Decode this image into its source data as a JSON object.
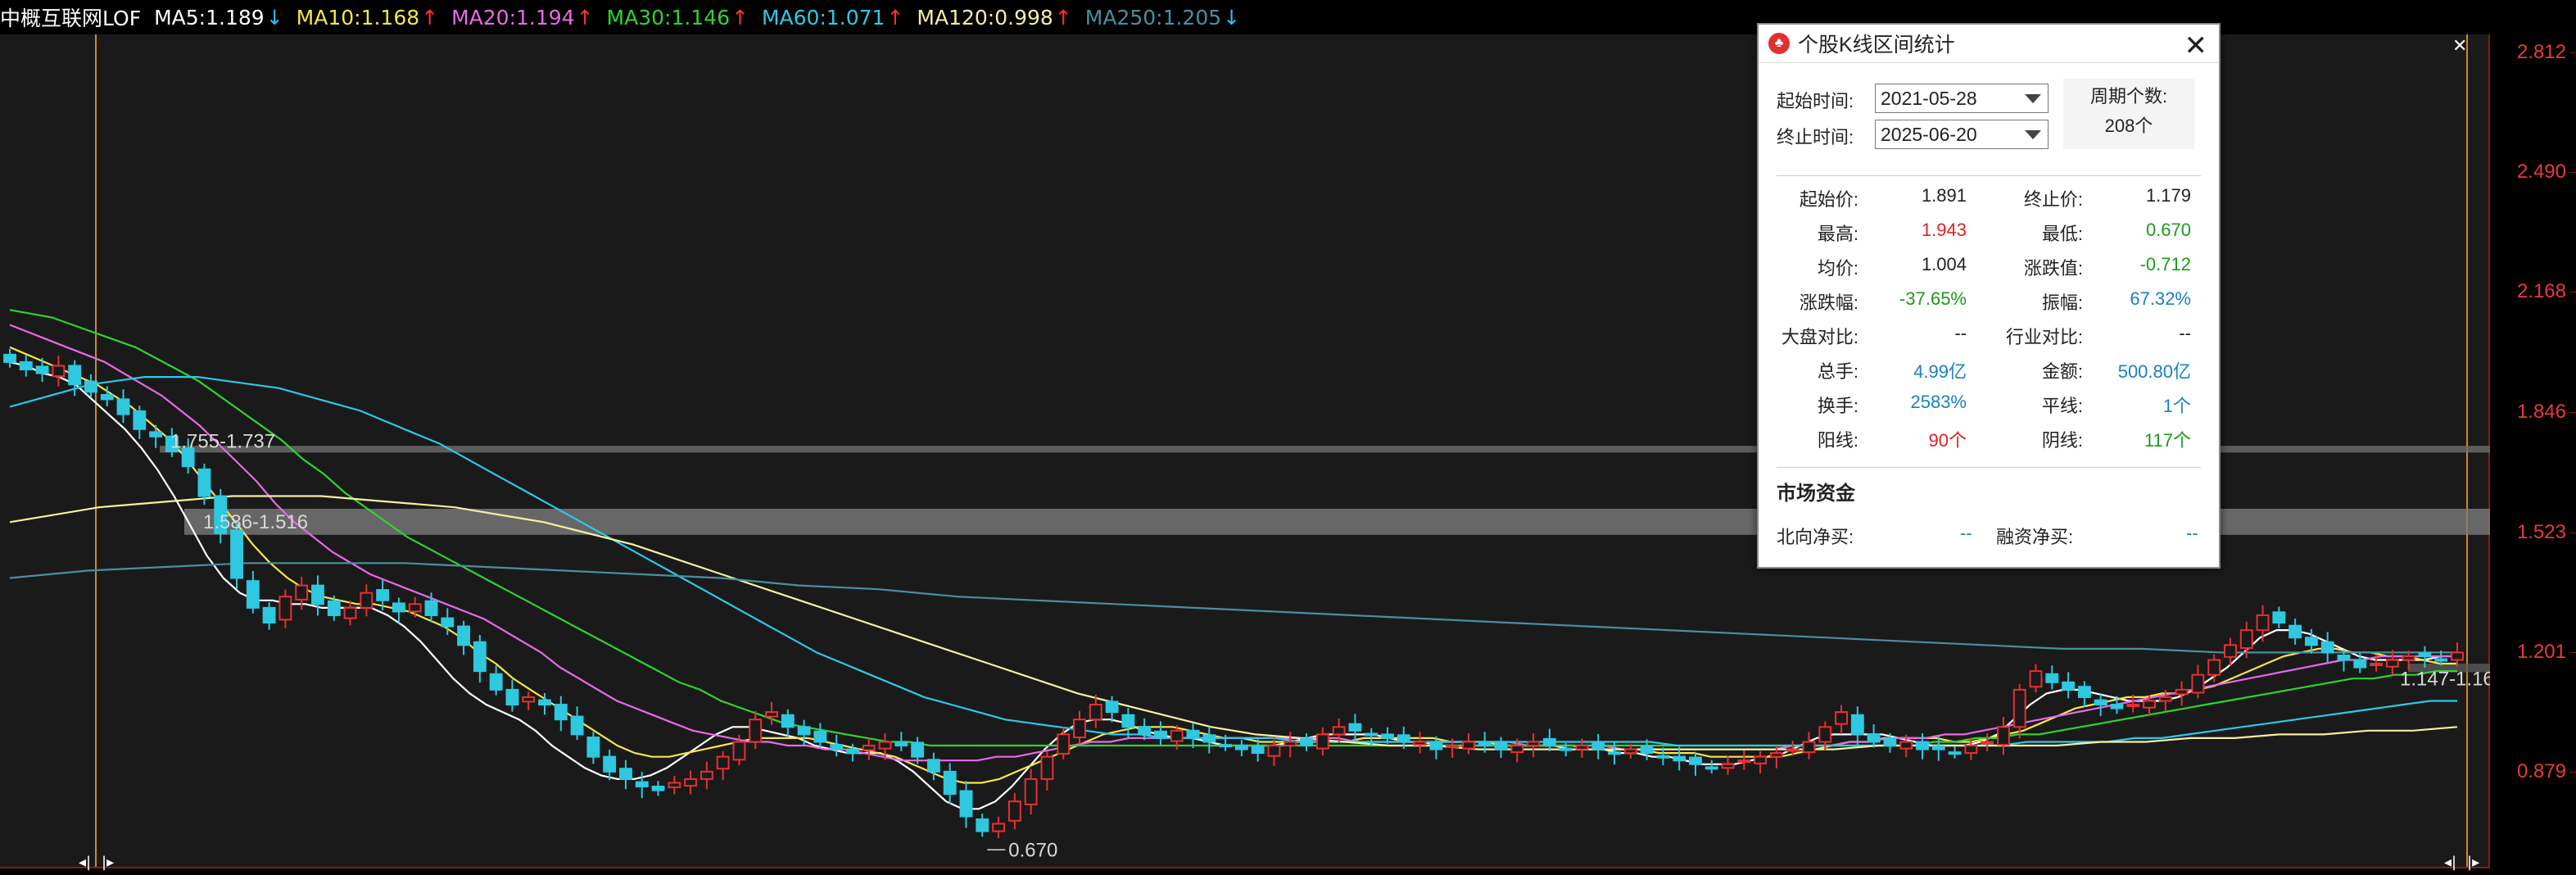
{
  "header": {
    "title": "中概互联网LOF",
    "indicators": [
      {
        "label": "MA5:",
        "value": "1.189",
        "arrow": "↓",
        "color": "#ffffff"
      },
      {
        "label": "MA10:",
        "value": "1.168",
        "arrow": "↑",
        "color": "#f5e64a"
      },
      {
        "label": "MA20:",
        "value": "1.194",
        "arrow": "↑",
        "color": "#e86ae8"
      },
      {
        "label": "MA30:",
        "value": "1.146",
        "arrow": "↑",
        "color": "#2fd42f"
      },
      {
        "label": "MA60:",
        "value": "1.071",
        "arrow": "↑",
        "color": "#2ec8e8"
      },
      {
        "label": "MA120:",
        "value": "0.998",
        "arrow": "↑",
        "color": "#f5f0a0"
      },
      {
        "label": "MA250:",
        "value": "1.205",
        "arrow": "↓",
        "color": "#4a8ea0"
      }
    ],
    "arrow_up_color": "#ff3030",
    "arrow_down_color": "#30c0f0"
  },
  "price_axis": [
    "2.812",
    "2.490",
    "2.168",
    "1.846",
    "1.523",
    "1.201",
    "0.879"
  ],
  "chart_annotations": {
    "zone1": "1.755-1.737",
    "zone2": "1.586-1.516",
    "zone3": "1.147-1.16",
    "low_label": "0.670"
  },
  "chart_data": {
    "type": "candlestick",
    "y_range": [
      0.62,
      2.86
    ],
    "up_color": "#e83030",
    "down_color": "#2ec8e0",
    "close_series": [
      1.98,
      1.96,
      1.95,
      1.97,
      1.92,
      1.9,
      1.88,
      1.84,
      1.8,
      1.78,
      1.74,
      1.7,
      1.62,
      1.52,
      1.4,
      1.32,
      1.28,
      1.35,
      1.38,
      1.33,
      1.3,
      1.32,
      1.36,
      1.34,
      1.31,
      1.33,
      1.3,
      1.27,
      1.22,
      1.15,
      1.1,
      1.06,
      1.08,
      1.06,
      1.02,
      0.98,
      0.92,
      0.88,
      0.86,
      0.84,
      0.83,
      0.85,
      0.86,
      0.88,
      0.92,
      0.96,
      1.02,
      1.04,
      1.0,
      0.98,
      0.96,
      0.94,
      0.93,
      0.95,
      0.96,
      0.95,
      0.92,
      0.88,
      0.82,
      0.76,
      0.72,
      0.74,
      0.8,
      0.86,
      0.92,
      0.98,
      1.02,
      1.06,
      1.04,
      1.0,
      0.98,
      0.97,
      0.99,
      0.97,
      0.96,
      0.95,
      0.94,
      0.93,
      0.95,
      0.96,
      0.95,
      0.98,
      1.0,
      0.99,
      0.98,
      0.97,
      0.96,
      0.96,
      0.94,
      0.95,
      0.96,
      0.95,
      0.94,
      0.95,
      0.96,
      0.95,
      0.94,
      0.95,
      0.94,
      0.93,
      0.94,
      0.93,
      0.92,
      0.91,
      0.9,
      0.89,
      0.9,
      0.91,
      0.92,
      0.93,
      0.94,
      0.96,
      1.0,
      1.04,
      0.98,
      0.96,
      0.95,
      0.96,
      0.94,
      0.94,
      0.93,
      0.95,
      0.96,
      1.0,
      1.1,
      1.15,
      1.12,
      1.1,
      1.08,
      1.06,
      1.05,
      1.06,
      1.07,
      1.08,
      1.1,
      1.14,
      1.18,
      1.22,
      1.26,
      1.3,
      1.28,
      1.24,
      1.22,
      1.2,
      1.18,
      1.16,
      1.17,
      1.18,
      1.19,
      1.19,
      1.18,
      1.2
    ],
    "ma_series": [
      {
        "name": "MA5",
        "color": "#ffffff",
        "values": [
          1.98,
          1.97,
          1.95,
          1.94,
          1.92,
          1.88,
          1.84,
          1.8,
          1.75,
          1.69,
          1.62,
          1.54,
          1.46,
          1.4,
          1.36,
          1.34,
          1.34,
          1.33,
          1.33,
          1.32,
          1.32,
          1.32,
          1.32,
          1.3,
          1.27,
          1.23,
          1.18,
          1.13,
          1.09,
          1.06,
          1.04,
          1.02,
          0.99,
          0.95,
          0.92,
          0.89,
          0.87,
          0.86,
          0.86,
          0.87,
          0.89,
          0.92,
          0.95,
          0.98,
          1.0,
          1.0,
          0.99,
          0.98,
          0.97,
          0.95,
          0.94,
          0.93,
          0.93,
          0.93,
          0.91,
          0.88,
          0.84,
          0.8,
          0.78,
          0.78,
          0.8,
          0.84,
          0.89,
          0.94,
          0.98,
          1.01,
          1.02,
          1.02,
          1.01,
          0.99,
          0.98,
          0.97,
          0.97,
          0.96,
          0.95,
          0.95,
          0.95,
          0.95,
          0.96,
          0.97,
          0.98,
          0.98,
          0.98,
          0.98,
          0.97,
          0.96,
          0.96,
          0.95,
          0.95,
          0.95,
          0.95,
          0.95,
          0.95,
          0.95,
          0.95,
          0.94,
          0.94,
          0.94,
          0.93,
          0.93,
          0.92,
          0.92,
          0.91,
          0.9,
          0.9,
          0.9,
          0.91,
          0.92,
          0.93,
          0.95,
          0.97,
          0.98,
          0.98,
          0.98,
          0.98,
          0.97,
          0.96,
          0.95,
          0.95,
          0.95,
          0.96,
          0.98,
          1.02,
          1.06,
          1.09,
          1.1,
          1.1,
          1.09,
          1.08,
          1.07,
          1.07,
          1.07,
          1.08,
          1.1,
          1.13,
          1.16,
          1.2,
          1.24,
          1.26,
          1.26,
          1.25,
          1.23,
          1.21,
          1.19,
          1.18,
          1.18,
          1.18,
          1.18,
          1.19,
          1.19
        ]
      },
      {
        "name": "MA10",
        "color": "#f5e64a",
        "values": [
          2.02,
          2.0,
          1.98,
          1.96,
          1.94,
          1.92,
          1.89,
          1.86,
          1.82,
          1.78,
          1.73,
          1.67,
          1.61,
          1.55,
          1.49,
          1.44,
          1.4,
          1.37,
          1.35,
          1.34,
          1.33,
          1.33,
          1.32,
          1.31,
          1.29,
          1.27,
          1.24,
          1.2,
          1.17,
          1.13,
          1.1,
          1.07,
          1.04,
          1.01,
          0.98,
          0.95,
          0.93,
          0.92,
          0.92,
          0.93,
          0.94,
          0.95,
          0.96,
          0.97,
          0.97,
          0.97,
          0.97,
          0.96,
          0.95,
          0.94,
          0.93,
          0.92,
          0.9,
          0.88,
          0.86,
          0.85,
          0.85,
          0.86,
          0.88,
          0.9,
          0.92,
          0.94,
          0.96,
          0.98,
          0.99,
          1.0,
          1.0,
          1.0,
          0.99,
          0.98,
          0.97,
          0.97,
          0.96,
          0.96,
          0.96,
          0.96,
          0.96,
          0.96,
          0.97,
          0.97,
          0.97,
          0.97,
          0.97,
          0.96,
          0.96,
          0.96,
          0.95,
          0.95,
          0.95,
          0.95,
          0.95,
          0.94,
          0.94,
          0.94,
          0.94,
          0.93,
          0.93,
          0.93,
          0.92,
          0.92,
          0.92,
          0.92,
          0.92,
          0.93,
          0.94,
          0.95,
          0.96,
          0.96,
          0.97,
          0.97,
          0.97,
          0.97,
          0.96,
          0.96,
          0.97,
          0.98,
          0.99,
          1.01,
          1.03,
          1.05,
          1.06,
          1.07,
          1.08,
          1.08,
          1.09,
          1.09,
          1.1,
          1.11,
          1.13,
          1.15,
          1.17,
          1.19,
          1.2,
          1.21,
          1.21,
          1.2,
          1.2,
          1.19,
          1.19,
          1.18,
          1.17,
          1.17
        ]
      },
      {
        "name": "MA20",
        "color": "#e86ae8",
        "values": [
          2.08,
          2.06,
          2.04,
          2.02,
          2.0,
          1.98,
          1.95,
          1.92,
          1.89,
          1.85,
          1.81,
          1.76,
          1.71,
          1.66,
          1.6,
          1.55,
          1.51,
          1.47,
          1.44,
          1.41,
          1.39,
          1.37,
          1.35,
          1.33,
          1.31,
          1.29,
          1.26,
          1.23,
          1.2,
          1.16,
          1.13,
          1.1,
          1.07,
          1.05,
          1.03,
          1.01,
          0.99,
          0.98,
          0.97,
          0.96,
          0.96,
          0.95,
          0.95,
          0.94,
          0.94,
          0.93,
          0.92,
          0.91,
          0.91,
          0.91,
          0.91,
          0.91,
          0.92,
          0.92,
          0.93,
          0.94,
          0.95,
          0.96,
          0.96,
          0.97,
          0.97,
          0.97,
          0.97,
          0.97,
          0.97,
          0.97,
          0.97,
          0.97,
          0.97,
          0.97,
          0.97,
          0.96,
          0.96,
          0.96,
          0.96,
          0.96,
          0.96,
          0.96,
          0.96,
          0.96,
          0.95,
          0.95,
          0.95,
          0.95,
          0.95,
          0.94,
          0.94,
          0.94,
          0.94,
          0.94,
          0.94,
          0.94,
          0.94,
          0.94,
          0.95,
          0.95,
          0.95,
          0.96,
          0.96,
          0.97,
          0.97,
          0.97,
          0.98,
          0.98,
          0.99,
          1.0,
          1.01,
          1.02,
          1.03,
          1.04,
          1.05,
          1.06,
          1.07,
          1.08,
          1.09,
          1.1,
          1.11,
          1.12,
          1.13,
          1.14,
          1.15,
          1.16,
          1.17,
          1.18,
          1.18,
          1.19,
          1.19,
          1.19,
          1.19,
          1.19
        ]
      },
      {
        "name": "MA30",
        "color": "#2fd42f",
        "values": [
          2.12,
          2.11,
          2.1,
          2.08,
          2.06,
          2.04,
          2.02,
          1.99,
          1.96,
          1.93,
          1.89,
          1.85,
          1.81,
          1.77,
          1.72,
          1.68,
          1.63,
          1.59,
          1.55,
          1.51,
          1.48,
          1.45,
          1.42,
          1.39,
          1.36,
          1.33,
          1.3,
          1.27,
          1.24,
          1.21,
          1.18,
          1.15,
          1.12,
          1.1,
          1.07,
          1.05,
          1.03,
          1.01,
          1.0,
          0.99,
          0.98,
          0.97,
          0.96,
          0.96,
          0.95,
          0.95,
          0.95,
          0.95,
          0.95,
          0.95,
          0.95,
          0.95,
          0.95,
          0.95,
          0.95,
          0.95,
          0.95,
          0.95,
          0.95,
          0.95,
          0.95,
          0.95,
          0.95,
          0.95,
          0.95,
          0.95,
          0.95,
          0.95,
          0.95,
          0.95,
          0.95,
          0.95,
          0.95,
          0.95,
          0.95,
          0.95,
          0.95,
          0.95,
          0.95,
          0.95,
          0.95,
          0.95,
          0.95,
          0.95,
          0.95,
          0.95,
          0.95,
          0.95,
          0.95,
          0.95,
          0.95,
          0.95,
          0.96,
          0.96,
          0.97,
          0.97,
          0.98,
          0.98,
          0.99,
          1.0,
          1.01,
          1.02,
          1.03,
          1.04,
          1.05,
          1.06,
          1.07,
          1.08,
          1.09,
          1.1,
          1.11,
          1.12,
          1.13,
          1.13,
          1.14,
          1.14,
          1.15,
          1.15
        ]
      },
      {
        "name": "MA60",
        "color": "#2ec8e8",
        "values": [
          1.86,
          1.88,
          1.9,
          1.92,
          1.93,
          1.94,
          1.94,
          1.94,
          1.93,
          1.92,
          1.91,
          1.89,
          1.87,
          1.85,
          1.82,
          1.79,
          1.76,
          1.72,
          1.68,
          1.64,
          1.6,
          1.56,
          1.52,
          1.48,
          1.44,
          1.4,
          1.36,
          1.32,
          1.28,
          1.24,
          1.2,
          1.17,
          1.14,
          1.11,
          1.08,
          1.06,
          1.04,
          1.02,
          1.01,
          1.0,
          0.99,
          0.98,
          0.98,
          0.97,
          0.97,
          0.97,
          0.97,
          0.97,
          0.96,
          0.96,
          0.96,
          0.96,
          0.96,
          0.96,
          0.96,
          0.96,
          0.96,
          0.96,
          0.96,
          0.96,
          0.96,
          0.96,
          0.95,
          0.95,
          0.95,
          0.95,
          0.95,
          0.95,
          0.95,
          0.95,
          0.95,
          0.95,
          0.95,
          0.95,
          0.95,
          0.96,
          0.96,
          0.96,
          0.96,
          0.97,
          0.97,
          0.98,
          0.99,
          1.0,
          1.01,
          1.02,
          1.03,
          1.04,
          1.05,
          1.06,
          1.07,
          1.07
        ]
      },
      {
        "name": "MA120",
        "color": "#f5f0a0",
        "values": [
          1.55,
          1.57,
          1.59,
          1.6,
          1.61,
          1.62,
          1.62,
          1.62,
          1.61,
          1.6,
          1.59,
          1.57,
          1.55,
          1.52,
          1.49,
          1.45,
          1.41,
          1.37,
          1.33,
          1.29,
          1.25,
          1.21,
          1.17,
          1.13,
          1.09,
          1.06,
          1.03,
          1.0,
          0.98,
          0.97,
          0.96,
          0.95,
          0.95,
          0.94,
          0.94,
          0.94,
          0.94,
          0.94,
          0.94,
          0.94,
          0.94,
          0.94,
          0.95,
          0.95,
          0.95,
          0.95,
          0.95,
          0.96,
          0.96,
          0.97,
          0.97,
          0.98,
          0.98,
          0.99,
          0.99,
          1.0
        ]
      },
      {
        "name": "MA250",
        "color": "#4a8ea0",
        "values": [
          1.4,
          1.42,
          1.43,
          1.44,
          1.44,
          1.44,
          1.43,
          1.42,
          1.41,
          1.4,
          1.38,
          1.37,
          1.35,
          1.34,
          1.33,
          1.32,
          1.31,
          1.3,
          1.29,
          1.28,
          1.27,
          1.26,
          1.25,
          1.24,
          1.23,
          1.22,
          1.21,
          1.21,
          1.2,
          1.2,
          1.2,
          1.2
        ]
      }
    ]
  },
  "dialog": {
    "title": "个股K线区间统计",
    "close": "✕",
    "start_label": "起始时间:",
    "start_value": "2021-05-28",
    "end_label": "终止时间:",
    "end_value": "2025-06-20",
    "period_label": "周期个数:",
    "period_value": "208个",
    "stats": [
      {
        "l1": "起始价:",
        "v1": "1.891",
        "c1": "#222222",
        "l2": "终止价:",
        "v2": "1.179",
        "c2": "#222222"
      },
      {
        "l1": "最高:",
        "v1": "1.943",
        "c1": "#e02020",
        "l2": "最低:",
        "v2": "0.670",
        "c2": "#1a9a1a"
      },
      {
        "l1": "均价:",
        "v1": "1.004",
        "c1": "#222222",
        "l2": "涨跌值:",
        "v2": "-0.712",
        "c2": "#1a9a1a"
      },
      {
        "l1": "涨跌幅:",
        "v1": "-37.65%",
        "c1": "#1a9a1a",
        "l2": "振幅:",
        "v2": "67.32%",
        "c2": "#1a80c0"
      },
      {
        "l1": "大盘对比:",
        "v1": "--",
        "c1": "#222222",
        "l2": "行业对比:",
        "v2": "--",
        "c2": "#222222"
      },
      {
        "l1": "总手:",
        "v1": "4.99亿",
        "c1": "#1a80c0",
        "l2": "金额:",
        "v2": "500.80亿",
        "c2": "#1a80c0"
      },
      {
        "l1": "换手:",
        "v1": "2583%",
        "c1": "#1a80c0",
        "l2": "平线:",
        "v2": "1个",
        "c2": "#1a80c0"
      },
      {
        "l1": "阳线:",
        "v1": "90个",
        "c1": "#e02020",
        "l2": "阴线:",
        "v2": "117个",
        "c2": "#1a9a1a"
      }
    ],
    "fund_title": "市场资金",
    "north_label": "北向净买:",
    "north_value": "--",
    "margin_label": "融资净买:",
    "margin_value": "--"
  }
}
